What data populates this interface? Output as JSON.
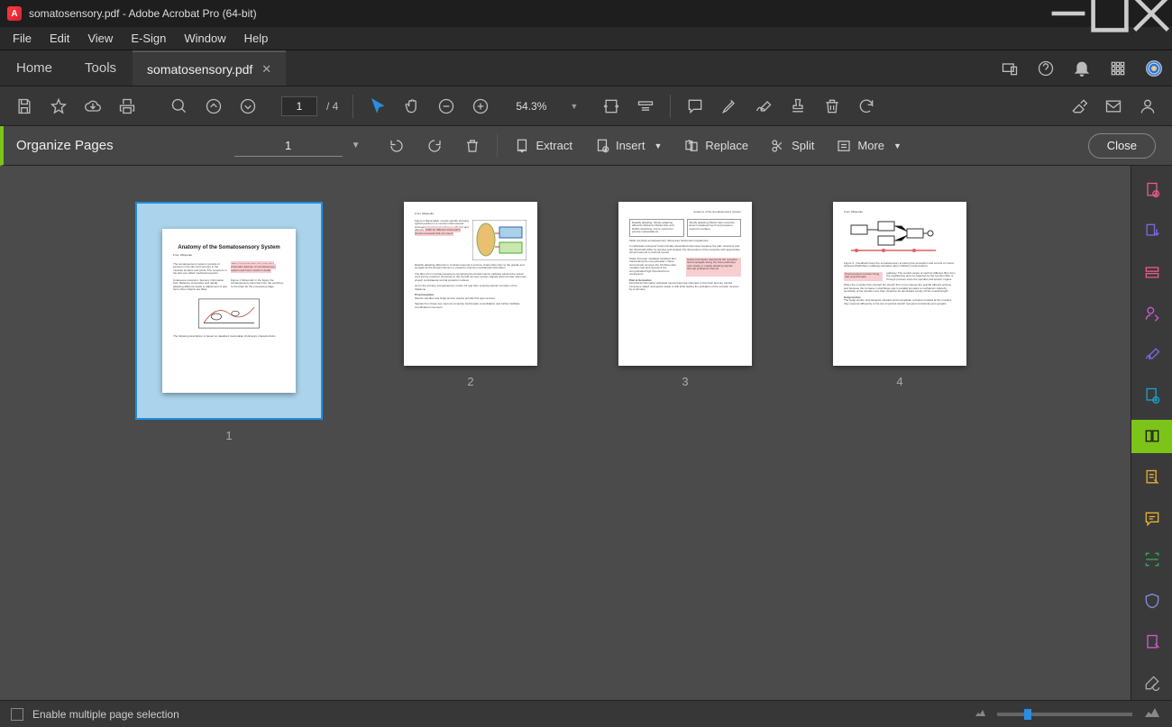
{
  "title": "somatosensory.pdf - Adobe Acrobat Pro (64-bit)",
  "menu": [
    "File",
    "Edit",
    "View",
    "E-Sign",
    "Window",
    "Help"
  ],
  "nav": {
    "home": "Home",
    "tools": "Tools"
  },
  "doc": {
    "name": "somatosensory.pdf"
  },
  "toolbar": {
    "page": "1",
    "pages": "4",
    "zoom": "54.3%"
  },
  "organize": {
    "title": "Organize Pages",
    "page": "1",
    "extract": "Extract",
    "insert": "Insert",
    "replace": "Replace",
    "split": "Split",
    "more": "More",
    "close": "Close"
  },
  "thumbs": [
    {
      "n": "1",
      "title": "Anatomy of the Somatosensory System",
      "sel": true
    },
    {
      "n": "2"
    },
    {
      "n": "3"
    },
    {
      "n": "4"
    }
  ],
  "footer": {
    "label": "Enable multiple page selection"
  }
}
